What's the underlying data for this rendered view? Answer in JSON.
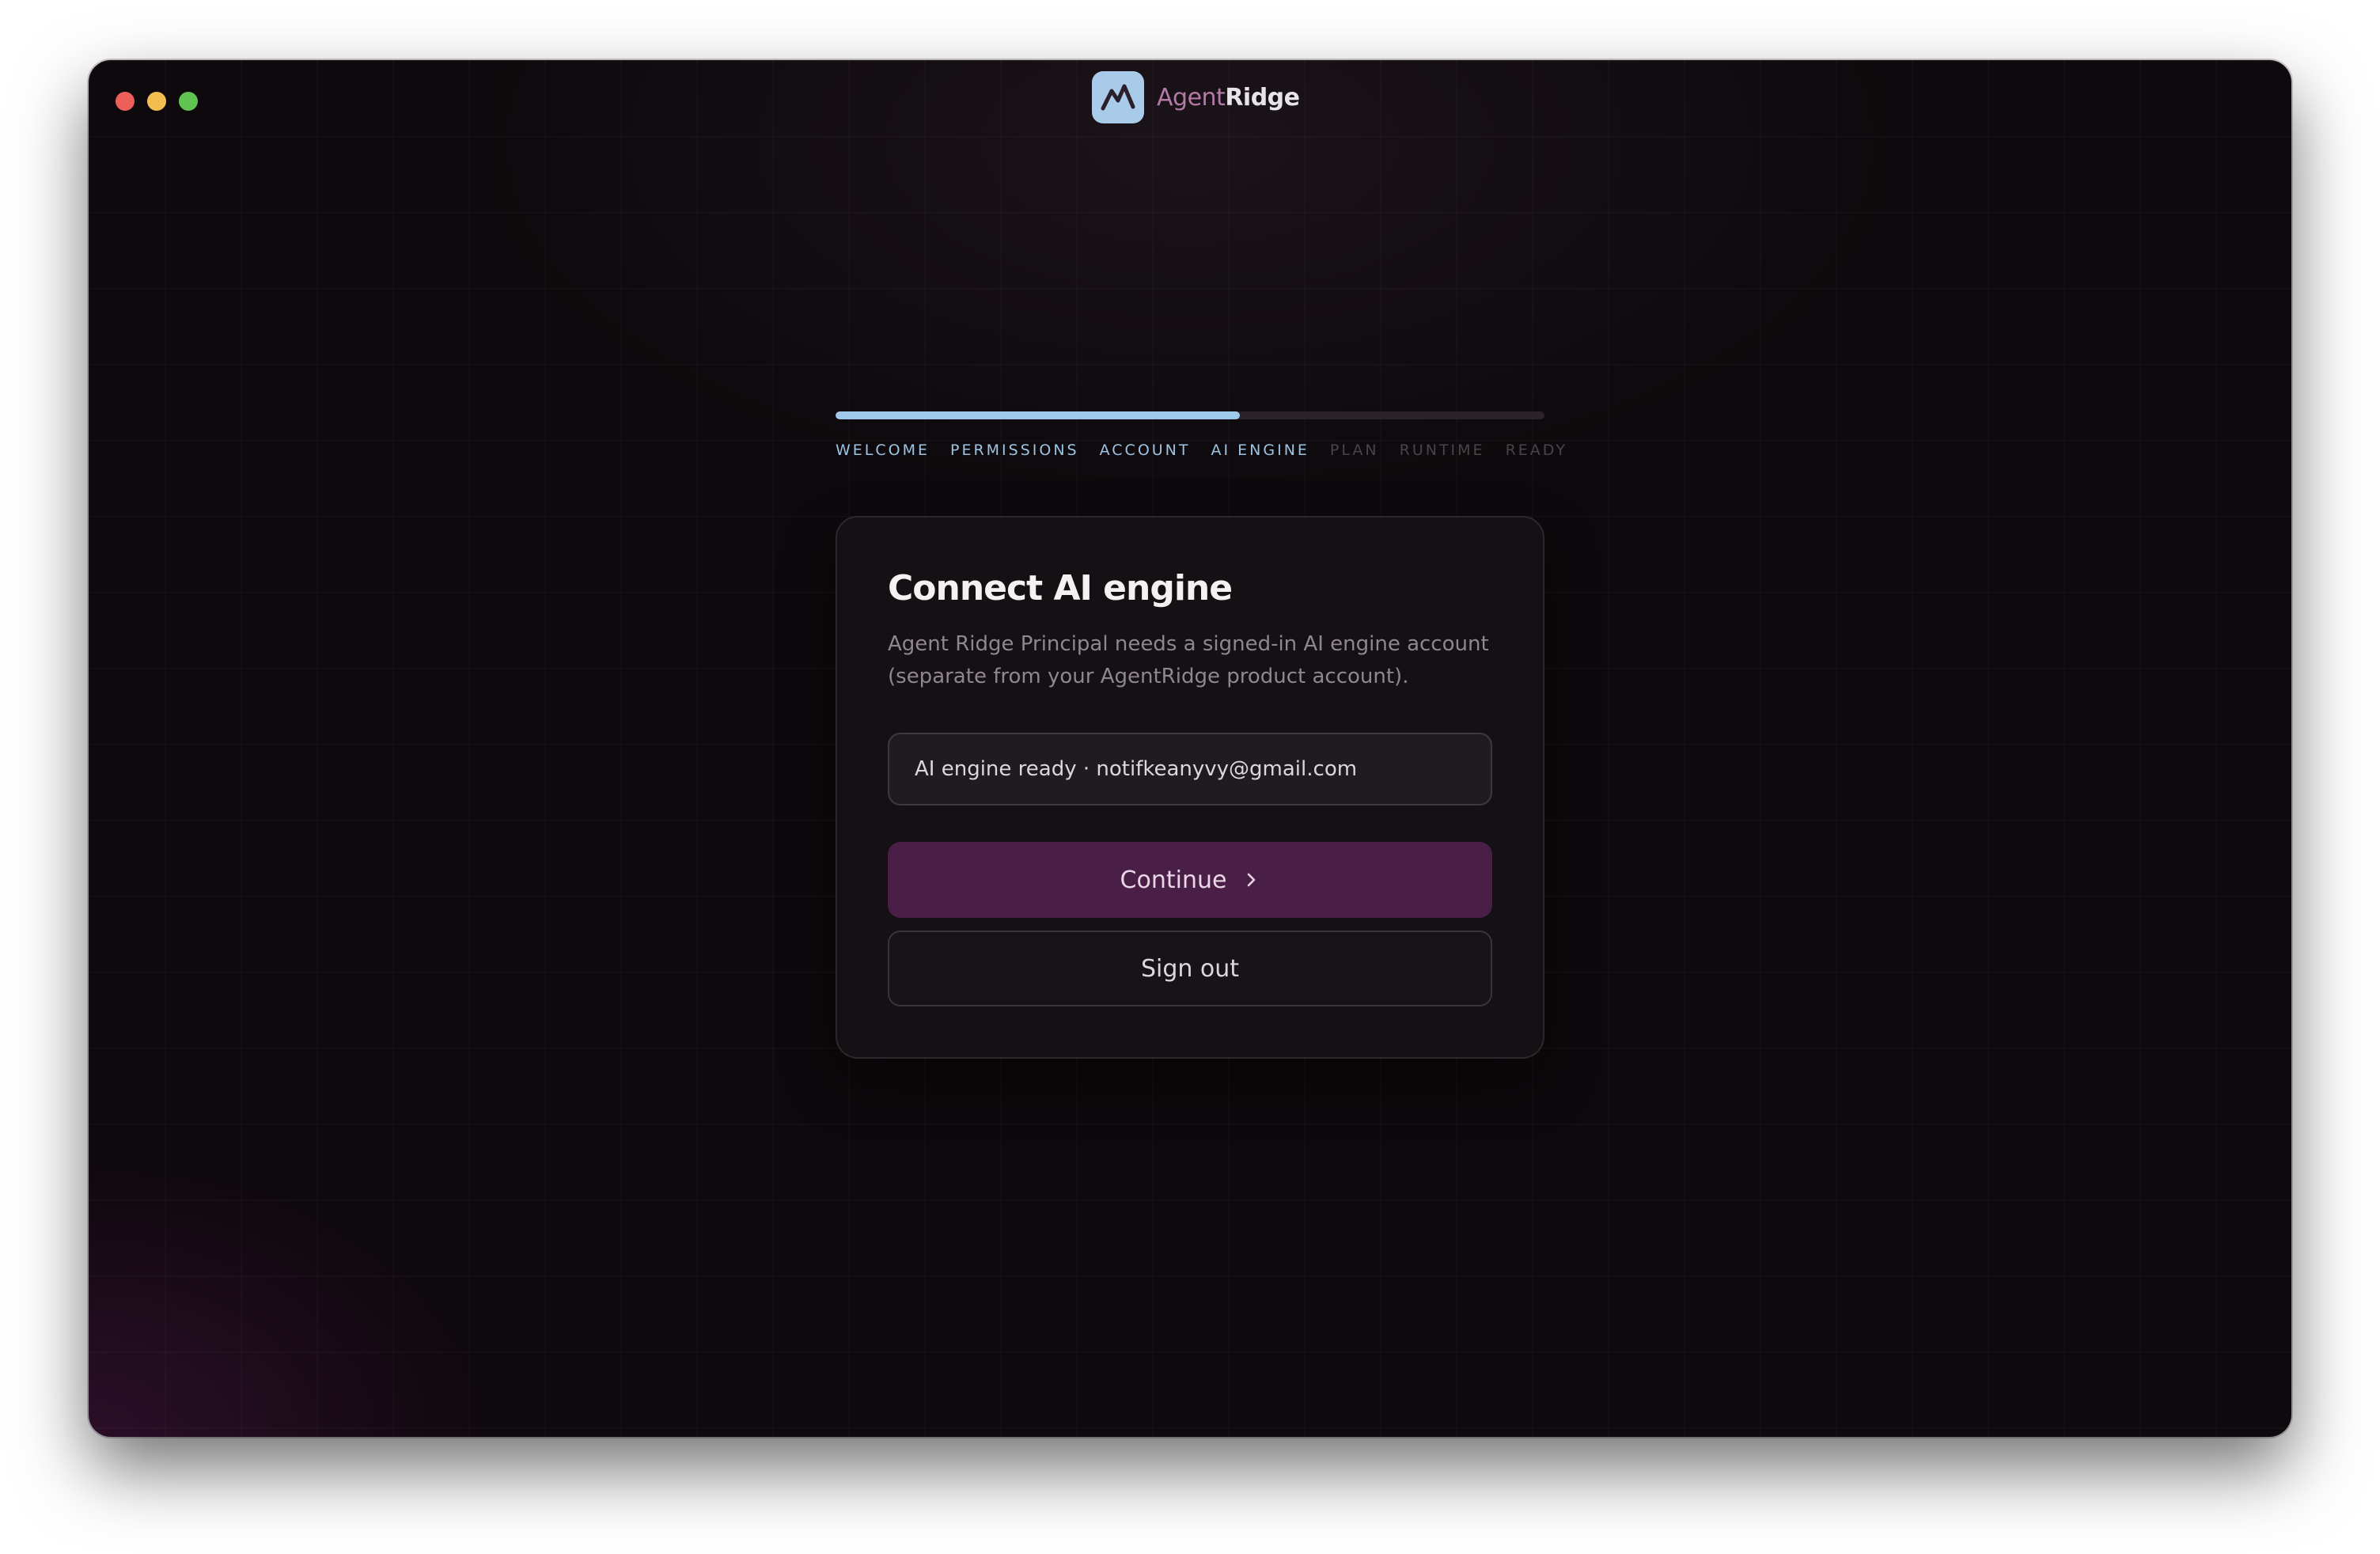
{
  "app": {
    "brand_prefix": "Agent",
    "brand_suffix": "Ridge",
    "logo_icon": "mountain-peak-icon"
  },
  "colors": {
    "accent": "#9fc9ea",
    "brand_purple": "#b47aa5",
    "continue_button": "#4a1f47",
    "background": "#0d090c"
  },
  "progress": {
    "fraction": 0.57,
    "steps": [
      {
        "label": "WELCOME",
        "state": "done"
      },
      {
        "label": "PERMISSIONS",
        "state": "done"
      },
      {
        "label": "ACCOUNT",
        "state": "done"
      },
      {
        "label": "AI ENGINE",
        "state": "done"
      },
      {
        "label": "PLAN",
        "state": "todo"
      },
      {
        "label": "RUNTIME",
        "state": "todo"
      },
      {
        "label": "READY",
        "state": "todo"
      }
    ]
  },
  "card": {
    "title": "Connect AI engine",
    "description": "Agent Ridge Principal needs a signed-in AI engine account (separate from your AgentRidge product account).",
    "status_text": "AI engine ready · notifkeanyvy@gmail.com",
    "continue_label": "Continue",
    "continue_icon": "chevron-right-icon",
    "signout_label": "Sign out"
  }
}
